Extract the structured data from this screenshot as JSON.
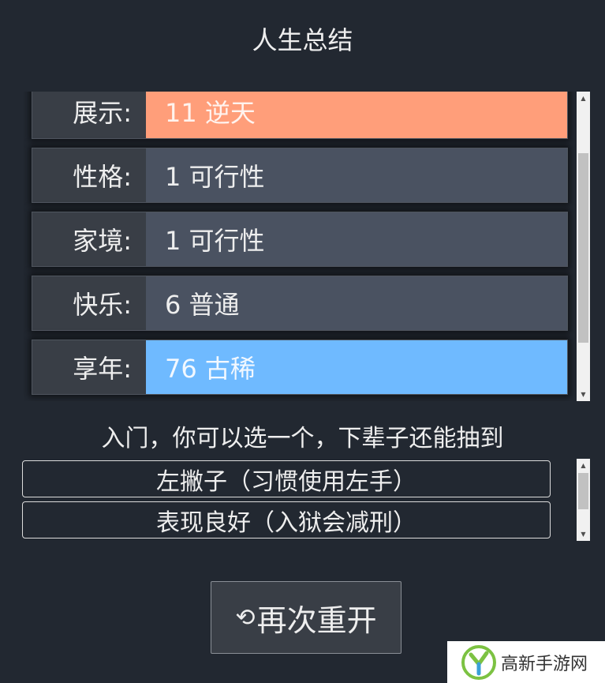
{
  "title": "人生总结",
  "summary": [
    {
      "label": "展示:",
      "value": "11 逆天",
      "grade": "orange"
    },
    {
      "label": "性格:",
      "value": "1 可行性",
      "grade": "normal"
    },
    {
      "label": "家境:",
      "value": "1 可行性",
      "grade": "normal"
    },
    {
      "label": "快乐:",
      "value": "6 普通",
      "grade": "normal"
    },
    {
      "label": "享年:",
      "value": "76 古稀",
      "grade": "blue"
    }
  ],
  "prompt": "入门，你可以选一个，下辈子还能抽到",
  "talents": [
    {
      "label": "左撇子（习惯使用左手）"
    },
    {
      "label": "表现良好（入狱会减刑）"
    }
  ],
  "restart_button": {
    "icon": "refresh-icon",
    "label": "再次重开"
  },
  "watermark": {
    "text": "高新手游网"
  },
  "colors": {
    "background": "#222831",
    "row": "#4a5261",
    "grade_orange": "#ff9e7a",
    "grade_blue": "#6fbaff"
  }
}
